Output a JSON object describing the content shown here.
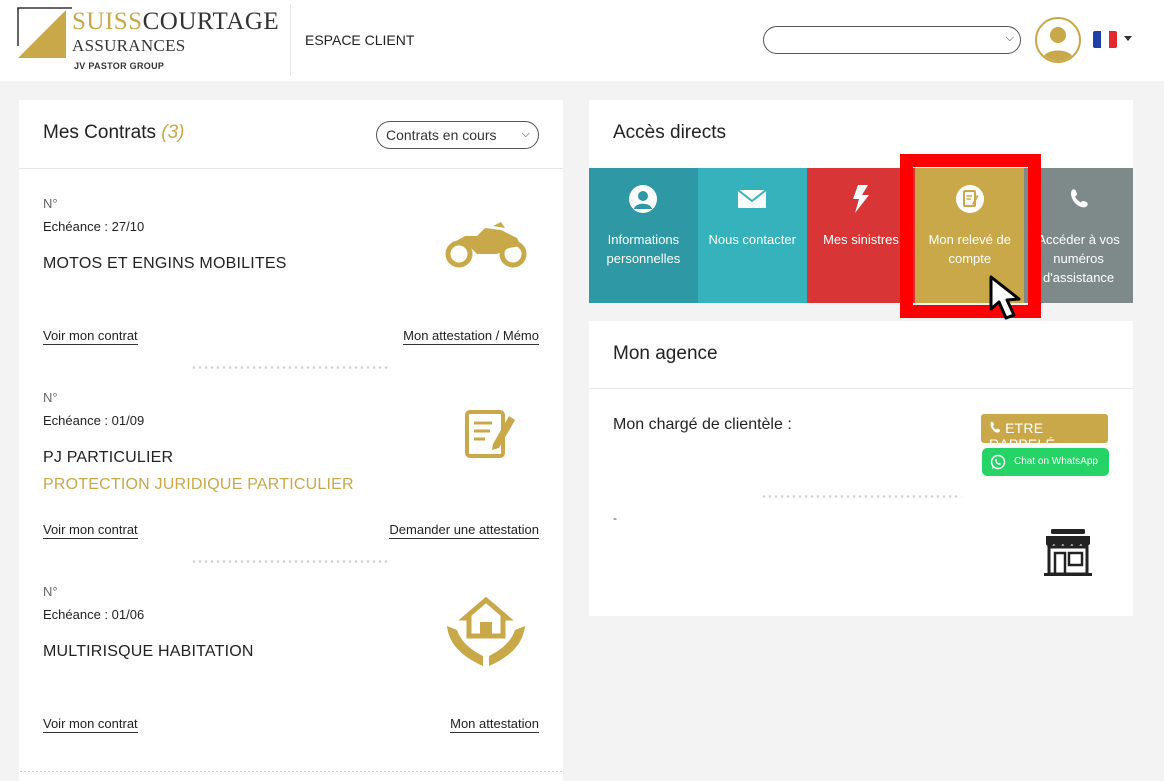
{
  "brand": {
    "name_part1": "SUISS",
    "name_part2": "COURTAGE",
    "name_line2": "ASSURANCES",
    "group": "JV PASTOR GROUP"
  },
  "header": {
    "space_label": "ESPACE CLIENT",
    "select_value": "",
    "language": "French"
  },
  "contracts_panel": {
    "title": "Mes Contrats",
    "count": "(3)",
    "filter_value": "Contrats en cours",
    "contracts": [
      {
        "number": "N°",
        "due": "Echéance : 27/10",
        "name": "MOTOS ET ENGINS MOBILITES",
        "subtitle": "",
        "icon": "motorcycle-icon",
        "link_left": "Voir mon contrat",
        "link_right": "Mon attestation / Mémo"
      },
      {
        "number": "N°",
        "due": "Echéance : 01/09",
        "name": "PJ PARTICULIER",
        "subtitle": "PROTECTION JURIDIQUE PARTICULIER",
        "icon": "document-pen-icon",
        "link_left": "Voir mon contrat",
        "link_right": "Demander une attestation"
      },
      {
        "number": "N°",
        "due": "Echéance : 01/06",
        "name": "MULTIRISQUE HABITATION",
        "subtitle": "",
        "icon": "house-hands-icon",
        "link_left": "Voir mon contrat",
        "link_right": "Mon attestation"
      }
    ]
  },
  "access_panel": {
    "title": "Accès directs",
    "tiles": [
      {
        "label": "Informations personnelles",
        "icon": "user-icon",
        "color": "#2e99a5"
      },
      {
        "label": "Nous contacter",
        "icon": "envelope-icon",
        "color": "#35b2bb"
      },
      {
        "label": "Mes sinistres",
        "icon": "lightning-icon",
        "color": "#d83636"
      },
      {
        "label": "Mon relevé de compte",
        "icon": "statement-icon",
        "color": "#c9a84a"
      },
      {
        "label": "Accéder à vos numéros d'assistance",
        "icon": "phone-icon",
        "color": "#7e8a8a"
      }
    ]
  },
  "agency_panel": {
    "title": "Mon agence",
    "manager_label": "Mon chargé de clientèle :",
    "call_button": "ETRE RAPPELÉ",
    "whatsapp_button": "Chat on WhatsApp",
    "agency_name": "-"
  },
  "colors": {
    "gold": "#c9a84a",
    "teal": "#2e99a5",
    "red": "#d83636",
    "highlight": "#ff0000",
    "whatsapp": "#25d366"
  }
}
